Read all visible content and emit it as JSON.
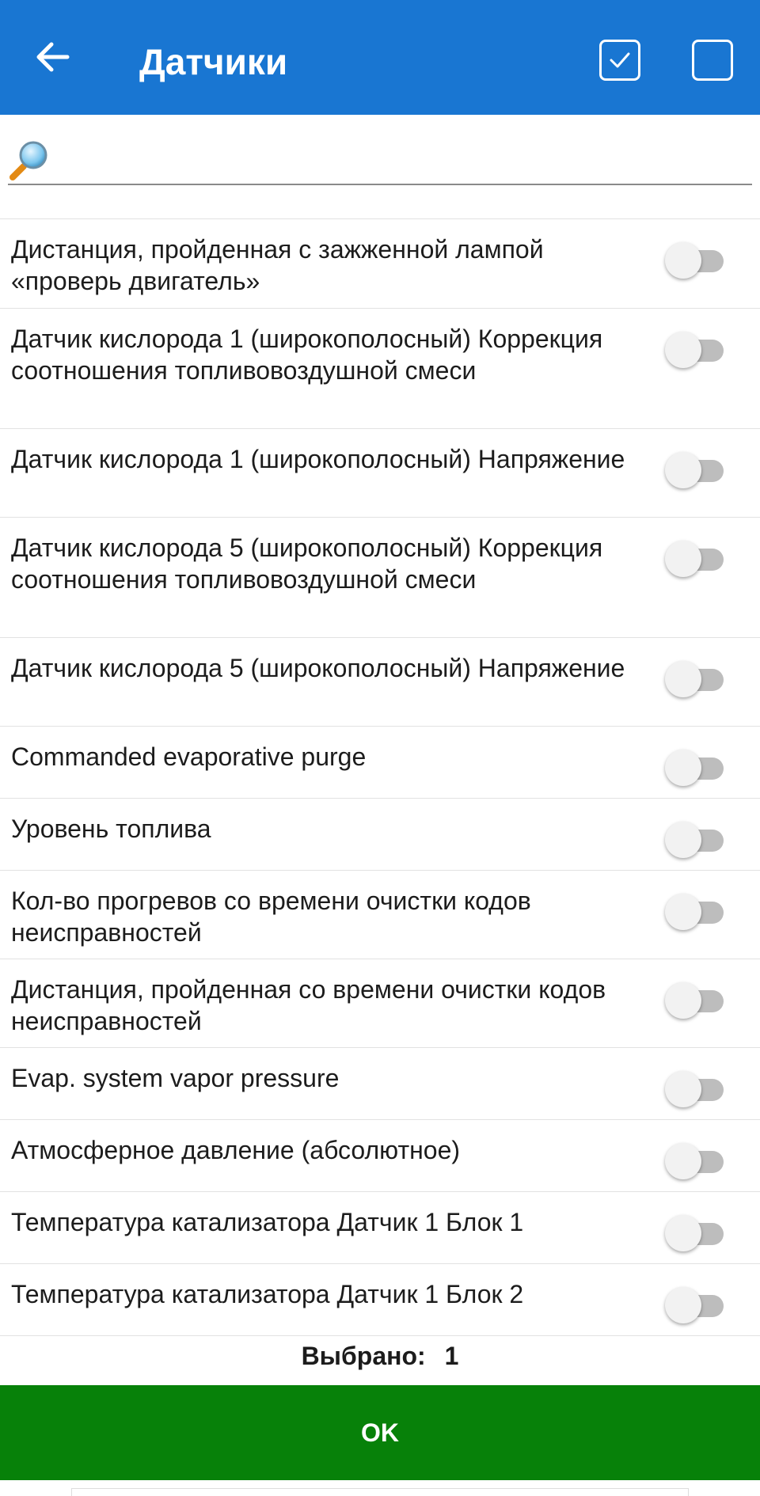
{
  "header": {
    "title": "Датчики",
    "back_icon": "arrow-left-icon",
    "select_all_icon": "checkbox-checked-icon",
    "select_none_icon": "checkbox-empty-icon",
    "bg_color": "#1976d2"
  },
  "search": {
    "icon": "magnifier-icon",
    "value": "",
    "placeholder": ""
  },
  "items": [
    {
      "label": "Дистанция, пройденная с зажженной лампой «проверь двигатель»",
      "enabled": false
    },
    {
      "label": "Датчик кислорода 1 (широкополосный) Коррекция соотношения топливовоздушной смеси",
      "enabled": false
    },
    {
      "label": "Датчик кислорода 1 (широкополосный) Напряжение",
      "enabled": false
    },
    {
      "label": "Датчик кислорода 5 (широкополосный) Коррекция соотношения топливовоздушной смеси",
      "enabled": false
    },
    {
      "label": "Датчик кислорода 5 (широкополосный) Напряжение",
      "enabled": false
    },
    {
      "label": "Commanded evaporative purge",
      "enabled": false
    },
    {
      "label": "Уровень топлива",
      "enabled": false
    },
    {
      "label": "Кол-во прогревов со времени очистки кодов неисправностей",
      "enabled": false
    },
    {
      "label": "Дистанция, пройденная со времени очистки кодов неисправностей",
      "enabled": false
    },
    {
      "label": "Evap. system vapor pressure",
      "enabled": false
    },
    {
      "label": "Атмосферное давление (абсолютное)",
      "enabled": false
    },
    {
      "label": "Температура катализатора Датчик 1 Блок 1",
      "enabled": false
    },
    {
      "label": "Температура катализатора Датчик 1 Блок 2",
      "enabled": false
    }
  ],
  "footer": {
    "selected_label": "Выбрано:",
    "selected_count": "1",
    "ok_label": "OK",
    "ok_color": "#078109"
  }
}
